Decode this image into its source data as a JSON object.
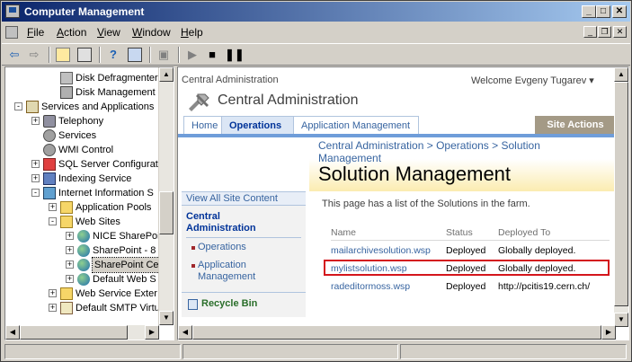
{
  "window": {
    "title": "Computer Management",
    "min": "_",
    "max": "□",
    "close": "✕"
  },
  "menu": [
    {
      "label": "File",
      "u": "F"
    },
    {
      "label": "Action",
      "u": "A"
    },
    {
      "label": "View",
      "u": "V"
    },
    {
      "label": "Window",
      "u": "W"
    },
    {
      "label": "Help",
      "u": "H"
    }
  ],
  "tree": [
    {
      "label": "Disk Defragmenter",
      "indent": 3,
      "exp": "",
      "icon": "defrag"
    },
    {
      "label": "Disk Management",
      "indent": 3,
      "exp": "",
      "icon": "disk"
    },
    {
      "label": "Services and Applications",
      "indent": 1,
      "exp": "-",
      "icon": "services"
    },
    {
      "label": "Telephony",
      "indent": 2,
      "exp": "+",
      "icon": "phone"
    },
    {
      "label": "Services",
      "indent": 2,
      "exp": "",
      "icon": "gear"
    },
    {
      "label": "WMI Control",
      "indent": 2,
      "exp": "",
      "icon": "gear"
    },
    {
      "label": "SQL Server Configurat",
      "indent": 2,
      "exp": "+",
      "icon": "sql"
    },
    {
      "label": "Indexing Service",
      "indent": 2,
      "exp": "+",
      "icon": "index"
    },
    {
      "label": "Internet Information S",
      "indent": 2,
      "exp": "-",
      "icon": "iis"
    },
    {
      "label": "Application Pools",
      "indent": 3,
      "exp": "+",
      "icon": "folder"
    },
    {
      "label": "Web Sites",
      "indent": 3,
      "exp": "-",
      "icon": "folder"
    },
    {
      "label": "NICE SharePoi",
      "indent": 4,
      "exp": "+",
      "icon": "globe"
    },
    {
      "label": "SharePoint - 8",
      "indent": 4,
      "exp": "+",
      "icon": "globe"
    },
    {
      "label": "SharePoint Ce",
      "indent": 4,
      "exp": "+",
      "icon": "globe",
      "selected": true
    },
    {
      "label": "Default Web S",
      "indent": 4,
      "exp": "+",
      "icon": "globe"
    },
    {
      "label": "Web Service Exter",
      "indent": 3,
      "exp": "+",
      "icon": "folder"
    },
    {
      "label": "Default SMTP Virtu",
      "indent": 3,
      "exp": "+",
      "icon": "smtp"
    }
  ],
  "sp": {
    "site_name": "Central Administration",
    "welcome": "Welcome Evgeny Tugarev",
    "welcome_caret": "▾",
    "title": "Central Administration",
    "tabs": [
      {
        "label": "Home",
        "active": false
      },
      {
        "label": "Operations",
        "active": true
      },
      {
        "label": "Application Management",
        "active": false
      }
    ],
    "site_actions": "Site Actions",
    "crumb1": "Central Administration",
    "crumb_sep": ">",
    "crumb2": "Operations",
    "crumb3a": "Solution",
    "crumb3b": "Management",
    "page_title": "Solution Management",
    "description": "This page has a list of the Solutions in the farm.",
    "nav": {
      "view_all": "View All Site Content",
      "heading_line1": "Central",
      "heading_line2": "Administration",
      "item1": "Operations",
      "item2_line1": "Application",
      "item2_line2": "Management",
      "recycle": "Recycle Bin"
    },
    "table": {
      "headers": [
        "Name",
        "Status",
        "Deployed To"
      ],
      "rows": [
        {
          "name": "mailarchivesolution.wsp",
          "status": "Deployed",
          "to": "Globally deployed.",
          "highlight": false
        },
        {
          "name": "mylistsolution.wsp",
          "status": "Deployed",
          "to": "Globally deployed.",
          "highlight": true
        },
        {
          "name": "radeditormoss.wsp",
          "status": "Deployed",
          "to": "http://pcitis19.cern.ch/",
          "highlight": false
        }
      ]
    }
  },
  "colors": {
    "title_start": "#0a246a",
    "title_end": "#a6caf0",
    "link": "#3764a0",
    "highlight_box": "#d4151c",
    "site_actions": "#a49a86"
  }
}
